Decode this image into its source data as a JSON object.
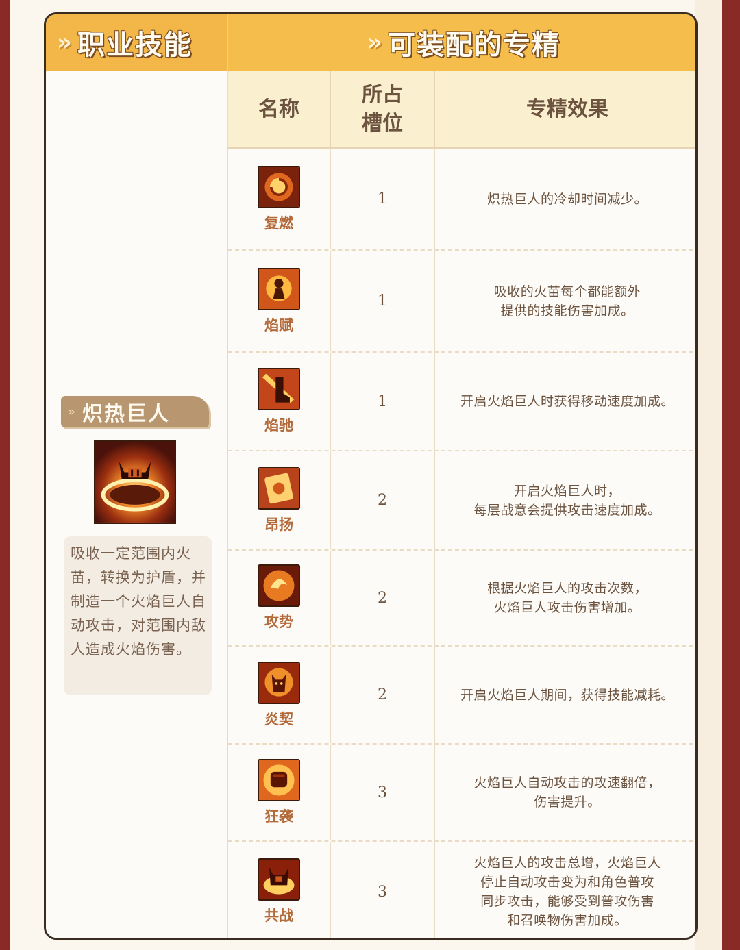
{
  "header": {
    "left_title": "职业技能",
    "right_title": "可装配的专精"
  },
  "skill": {
    "name": "炽热巨人",
    "description": "吸收一定范围内火苗，转换为护盾，并制造一个火焰巨人自动攻击，对范围内敌人造成火焰伤害。"
  },
  "table": {
    "columns": {
      "name": "名称",
      "slot": "所占槽位",
      "effect": "专精效果"
    },
    "rows": [
      {
        "name": "复燃",
        "slot": "1",
        "effect": "炽热巨人的冷却时间减少。",
        "icon": "fire-swirl-icon"
      },
      {
        "name": "焰赋",
        "slot": "1",
        "effect": "吸收的火苗每个都能额外\n提供的技能伤害加成。",
        "icon": "flame-figure-icon"
      },
      {
        "name": "焰驰",
        "slot": "1",
        "effect": "开启火焰巨人时获得移动速度加成。",
        "icon": "flame-boot-icon"
      },
      {
        "name": "昂扬",
        "slot": "2",
        "effect": "开启火焰巨人时，\n每层战意会提供攻击速度加成。",
        "icon": "flame-scroll-icon"
      },
      {
        "name": "攻势",
        "slot": "2",
        "effect": "根据火焰巨人的攻击次数，\n火焰巨人攻击伤害增加。",
        "icon": "flame-burst-icon"
      },
      {
        "name": "炎契",
        "slot": "2",
        "effect": "开启火焰巨人期间，获得技能减耗。",
        "icon": "flame-demon-icon"
      },
      {
        "name": "狂袭",
        "slot": "3",
        "effect": "火焰巨人自动攻击的攻速翻倍，\n伤害提升。",
        "icon": "flame-fist-icon"
      },
      {
        "name": "共战",
        "slot": "3",
        "effect": "火焰巨人的攻击总增，火焰巨人\n停止自动攻击变为和角色普攻\n同步攻击，能够受到普攻伤害\n和召唤物伤害加成。",
        "icon": "flame-helmet-icon"
      }
    ]
  }
}
